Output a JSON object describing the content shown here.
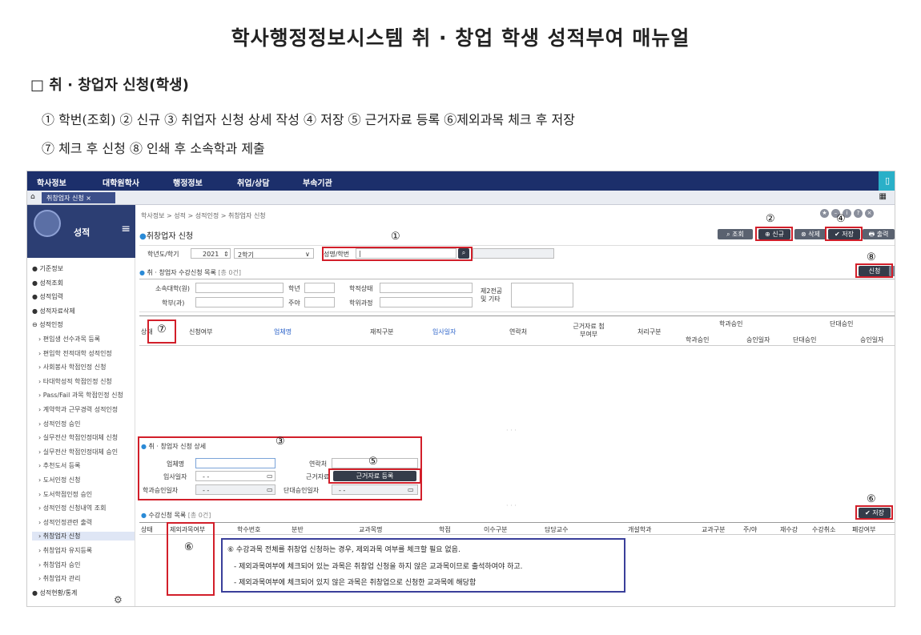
{
  "document": {
    "title": "학사행정정보시스템 취 · 창업 학생 성적부여 매뉴얼",
    "section_heading": "□ 취 · 창업자 신청(학생)",
    "steps_line1": "① 학번(조회) ② 신규 ③ 취업자 신청 상세 작성 ④ 저장 ⑤ 근거자료 등록 ⑥제외과목 체크 후 저장",
    "steps_line2": "⑦ 체크 후 신청 ⑧ 인쇄 후 소속학과 제출"
  },
  "topnav": {
    "items": [
      "학사정보",
      "대학원학사",
      "행정정보",
      "취업/상담",
      "부속기관"
    ],
    "right_icon": "bookmark-icon"
  },
  "tabbar": {
    "tab_label": "취창업자 신청 ×"
  },
  "sidebar": {
    "title": "성적",
    "items": [
      {
        "label": "기준정보",
        "type": "top"
      },
      {
        "label": "성적조회",
        "type": "top"
      },
      {
        "label": "성적입력",
        "type": "top"
      },
      {
        "label": "성적자료삭제",
        "type": "top"
      },
      {
        "label": "성적인정",
        "type": "open"
      },
      {
        "label": "편입생 선수과목 등록",
        "type": "sub"
      },
      {
        "label": "편입학 전적대학 성적인정",
        "type": "sub"
      },
      {
        "label": "사회봉사 학점인정 신청",
        "type": "sub"
      },
      {
        "label": "타대학성적 학점인정 신청",
        "type": "sub"
      },
      {
        "label": "Pass/Fail 과목 학점인정 신청",
        "type": "sub"
      },
      {
        "label": "계약학과 근무경력 성적인정",
        "type": "sub"
      },
      {
        "label": "성적인정 승인",
        "type": "sub"
      },
      {
        "label": "실무전산 학점인정대체 신청",
        "type": "sub"
      },
      {
        "label": "실무전산 학점인정대체 승인",
        "type": "sub"
      },
      {
        "label": "추천도서 등록",
        "type": "sub"
      },
      {
        "label": "도서인정 신청",
        "type": "sub"
      },
      {
        "label": "도서학점인정 승인",
        "type": "sub"
      },
      {
        "label": "성적인정 신청내역 조회",
        "type": "sub"
      },
      {
        "label": "성적인정관련 출력",
        "type": "sub"
      },
      {
        "label": "취창업자 신청",
        "type": "active"
      },
      {
        "label": "취창업자 유지등록",
        "type": "sub"
      },
      {
        "label": "취창업자 승인",
        "type": "sub"
      },
      {
        "label": "취창업자 관리",
        "type": "sub"
      },
      {
        "label": "성적현황/통계",
        "type": "top"
      }
    ]
  },
  "main": {
    "breadcrumb": "학사정보 > 성적 > 성적인정 > 취창업자 신청",
    "page_title": "취창업자 신청",
    "toolbar": {
      "search": "조회",
      "new": "신규",
      "delete": "삭제",
      "save": "저장",
      "print": "출력"
    },
    "filter": {
      "year_label": "학년도/학기",
      "year": "2021",
      "term": "2학기",
      "id_label": "성명/학번"
    },
    "list_section": {
      "title": "취 · 창업자 수강신청 목록",
      "count": "[총 0건]",
      "apply": "신청",
      "cancel": "취소"
    },
    "info_fields": {
      "college": "소속대학(원)",
      "dept": "학부(과)",
      "grade": "학년",
      "daynight": "주야",
      "status": "학적상태",
      "course": "학위과정",
      "second_major": "제2전공 및 기타"
    },
    "list_headers": [
      "상태",
      "신청여부",
      "업체명",
      "재직구분",
      "입사일자",
      "연락처",
      "근거자료 첨부여부",
      "처리구분",
      "학과승인",
      "학과승인",
      "승인일자",
      "단대승인",
      "단대승인",
      "승인일자"
    ],
    "detail_section": {
      "title": "취 · 창업자 신청 상세",
      "company": "업체명",
      "contact": "연락처",
      "join_date": "입사일자",
      "evidence": "근거자료",
      "evidence_btn": "근거자료 등록",
      "dept_approval": "학과승인일자",
      "college_approval": "단대승인일자",
      "date_placeholder": "- -"
    },
    "course_section": {
      "title": "수강신청 목록",
      "count": "[총 0건]",
      "save": "저장",
      "headers": [
        "상태",
        "제외과목여부",
        "학수번호",
        "분반",
        "교과목명",
        "학점",
        "이수구분",
        "담당교수",
        "개설학과",
        "교과구분",
        "주/야",
        "재수강",
        "수강취소",
        "폐강여부"
      ]
    },
    "note": {
      "line1": "⑥ 수강과목 전체를 취창업 신청하는 경우, 제외과목 여부를 체크할 필요 없음.",
      "line2": "- 제외과목여부에 체크되어 있는 과목은 취창업 신청을 하지 않은 교과목이므로 출석하여야 하고.",
      "line3": "- 제외과목여부에 체크되어 있지 않은 과목은 취창업으로 신청한 교과목에 해당함"
    },
    "callouts": [
      "①",
      "②",
      "③",
      "④",
      "⑤",
      "⑥",
      "⑦",
      "⑧"
    ]
  }
}
